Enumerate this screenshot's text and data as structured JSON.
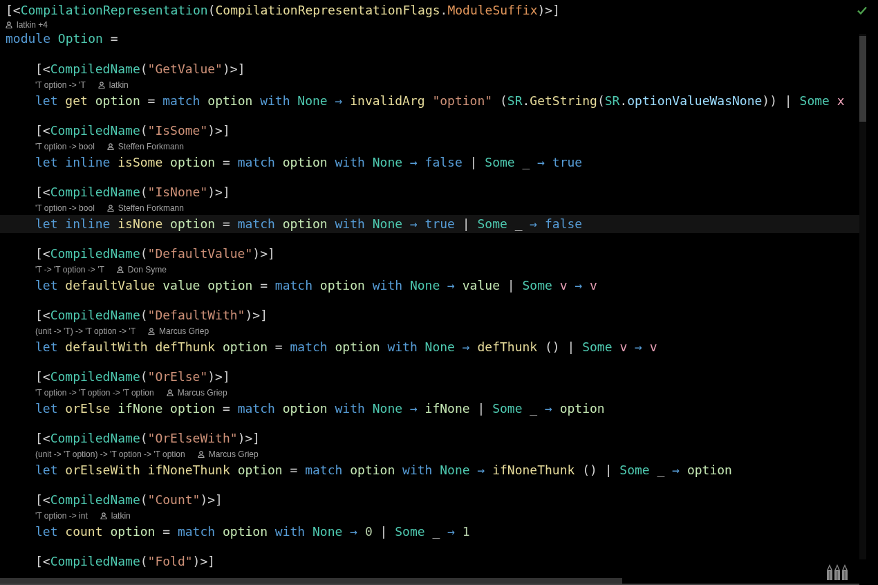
{
  "header": {
    "attribute": [
      {
        "t": "[<",
        "kind": "p"
      },
      {
        "t": "CompilationRepresentation",
        "kind": "ty"
      },
      {
        "t": "(",
        "kind": "p"
      },
      {
        "t": "CompilationRepresentationFlags",
        "kind": "fn"
      },
      {
        "t": ".",
        "kind": "p"
      },
      {
        "t": "ModuleSuffix",
        "kind": "en"
      },
      {
        "t": ")>]",
        "kind": "p"
      }
    ],
    "lens": {
      "author": "latkin +4"
    },
    "module": [
      {
        "t": "module ",
        "kind": "kw"
      },
      {
        "t": "Option",
        "kind": "ty"
      },
      {
        "t": " =",
        "kind": "p"
      }
    ]
  },
  "members": [
    {
      "attribute": [
        {
          "t": "[<",
          "kind": "p"
        },
        {
          "t": "CompiledName",
          "kind": "ty"
        },
        {
          "t": "(",
          "kind": "p"
        },
        {
          "t": "\"GetValue\"",
          "kind": "str"
        },
        {
          "t": ")>]",
          "kind": "p"
        }
      ],
      "lens": {
        "signature": "'T option -> 'T",
        "author": "latkin"
      },
      "current": false,
      "code": [
        {
          "t": "let ",
          "kind": "kw"
        },
        {
          "t": "get ",
          "kind": "fn"
        },
        {
          "t": "option ",
          "kind": "prm"
        },
        {
          "t": "= ",
          "kind": "p"
        },
        {
          "t": "match ",
          "kind": "kw"
        },
        {
          "t": "option ",
          "kind": "prm"
        },
        {
          "t": "with ",
          "kind": "kw"
        },
        {
          "t": "None ",
          "kind": "ty"
        },
        {
          "t": "→ ",
          "kind": "kw"
        },
        {
          "t": "invalidArg ",
          "kind": "fn"
        },
        {
          "t": "\"option\" ",
          "kind": "str"
        },
        {
          "t": "(",
          "kind": "p"
        },
        {
          "t": "SR",
          "kind": "ty"
        },
        {
          "t": ".",
          "kind": "p"
        },
        {
          "t": "GetString",
          "kind": "fn"
        },
        {
          "t": "(",
          "kind": "p"
        },
        {
          "t": "SR",
          "kind": "ty"
        },
        {
          "t": ".",
          "kind": "p"
        },
        {
          "t": "optionValueWasNone",
          "kind": "mem"
        },
        {
          "t": ")) | ",
          "kind": "p"
        },
        {
          "t": "Some ",
          "kind": "ty"
        },
        {
          "t": "x",
          "kind": "loc"
        }
      ]
    },
    {
      "attribute": [
        {
          "t": "[<",
          "kind": "p"
        },
        {
          "t": "CompiledName",
          "kind": "ty"
        },
        {
          "t": "(",
          "kind": "p"
        },
        {
          "t": "\"IsSome\"",
          "kind": "str"
        },
        {
          "t": ")>]",
          "kind": "p"
        }
      ],
      "lens": {
        "signature": "'T option -> bool",
        "author": "Steffen Forkmann"
      },
      "current": false,
      "code": [
        {
          "t": "let ",
          "kind": "kw"
        },
        {
          "t": "inline ",
          "kind": "kw"
        },
        {
          "t": "isSome ",
          "kind": "fn"
        },
        {
          "t": "option ",
          "kind": "prm"
        },
        {
          "t": "= ",
          "kind": "p"
        },
        {
          "t": "match ",
          "kind": "kw"
        },
        {
          "t": "option ",
          "kind": "prm"
        },
        {
          "t": "with ",
          "kind": "kw"
        },
        {
          "t": "None ",
          "kind": "ty"
        },
        {
          "t": "→ ",
          "kind": "kw"
        },
        {
          "t": "false ",
          "kind": "kw"
        },
        {
          "t": "| ",
          "kind": "p"
        },
        {
          "t": "Some ",
          "kind": "ty"
        },
        {
          "t": "_ ",
          "kind": "p"
        },
        {
          "t": "→ ",
          "kind": "kw"
        },
        {
          "t": "true",
          "kind": "kw"
        }
      ]
    },
    {
      "attribute": [
        {
          "t": "[<",
          "kind": "p"
        },
        {
          "t": "CompiledName",
          "kind": "ty"
        },
        {
          "t": "(",
          "kind": "p"
        },
        {
          "t": "\"IsNone\"",
          "kind": "str"
        },
        {
          "t": ")>]",
          "kind": "p"
        }
      ],
      "lens": {
        "signature": "'T option -> bool",
        "author": "Steffen Forkmann"
      },
      "current": true,
      "code": [
        {
          "t": "let ",
          "kind": "kw"
        },
        {
          "t": "inline ",
          "kind": "kw"
        },
        {
          "t": "isNone ",
          "kind": "fn"
        },
        {
          "t": "option ",
          "kind": "prm"
        },
        {
          "t": "= ",
          "kind": "p"
        },
        {
          "t": "match ",
          "kind": "kw"
        },
        {
          "t": "option ",
          "kind": "prm"
        },
        {
          "t": "with ",
          "kind": "kw"
        },
        {
          "t": "None ",
          "kind": "ty"
        },
        {
          "t": "→ ",
          "kind": "kw"
        },
        {
          "t": "true ",
          "kind": "kw"
        },
        {
          "t": "| ",
          "kind": "p"
        },
        {
          "t": "Some ",
          "kind": "ty"
        },
        {
          "t": "_ ",
          "kind": "p"
        },
        {
          "t": "→ ",
          "kind": "kw"
        },
        {
          "t": "false",
          "kind": "kw"
        }
      ]
    },
    {
      "attribute": [
        {
          "t": "[<",
          "kind": "p"
        },
        {
          "t": "CompiledName",
          "kind": "ty"
        },
        {
          "t": "(",
          "kind": "p"
        },
        {
          "t": "\"DefaultValue\"",
          "kind": "str"
        },
        {
          "t": ")>]",
          "kind": "p"
        }
      ],
      "lens": {
        "signature": "'T -> 'T option -> 'T",
        "author": "Don Syme"
      },
      "current": false,
      "code": [
        {
          "t": "let ",
          "kind": "kw"
        },
        {
          "t": "defaultValue ",
          "kind": "fn"
        },
        {
          "t": "value ",
          "kind": "prm"
        },
        {
          "t": "option ",
          "kind": "prm"
        },
        {
          "t": "= ",
          "kind": "p"
        },
        {
          "t": "match ",
          "kind": "kw"
        },
        {
          "t": "option ",
          "kind": "prm"
        },
        {
          "t": "with ",
          "kind": "kw"
        },
        {
          "t": "None ",
          "kind": "ty"
        },
        {
          "t": "→ ",
          "kind": "kw"
        },
        {
          "t": "value ",
          "kind": "prm"
        },
        {
          "t": "| ",
          "kind": "p"
        },
        {
          "t": "Some ",
          "kind": "ty"
        },
        {
          "t": "v ",
          "kind": "loc"
        },
        {
          "t": "→ ",
          "kind": "kw"
        },
        {
          "t": "v",
          "kind": "loc"
        }
      ]
    },
    {
      "attribute": [
        {
          "t": "[<",
          "kind": "p"
        },
        {
          "t": "CompiledName",
          "kind": "ty"
        },
        {
          "t": "(",
          "kind": "p"
        },
        {
          "t": "\"DefaultWith\"",
          "kind": "str"
        },
        {
          "t": ")>]",
          "kind": "p"
        }
      ],
      "lens": {
        "signature": "(unit -> 'T) -> 'T option -> 'T",
        "author": "Marcus Griep"
      },
      "current": false,
      "code": [
        {
          "t": "let ",
          "kind": "kw"
        },
        {
          "t": "defaultWith ",
          "kind": "fn"
        },
        {
          "t": "defThunk ",
          "kind": "fn"
        },
        {
          "t": "option ",
          "kind": "prm"
        },
        {
          "t": "= ",
          "kind": "p"
        },
        {
          "t": "match ",
          "kind": "kw"
        },
        {
          "t": "option ",
          "kind": "prm"
        },
        {
          "t": "with ",
          "kind": "kw"
        },
        {
          "t": "None ",
          "kind": "ty"
        },
        {
          "t": "→ ",
          "kind": "kw"
        },
        {
          "t": "defThunk ",
          "kind": "fn"
        },
        {
          "t": "() | ",
          "kind": "p"
        },
        {
          "t": "Some ",
          "kind": "ty"
        },
        {
          "t": "v ",
          "kind": "loc"
        },
        {
          "t": "→ ",
          "kind": "kw"
        },
        {
          "t": "v",
          "kind": "loc"
        }
      ]
    },
    {
      "attribute": [
        {
          "t": "[<",
          "kind": "p"
        },
        {
          "t": "CompiledName",
          "kind": "ty"
        },
        {
          "t": "(",
          "kind": "p"
        },
        {
          "t": "\"OrElse\"",
          "kind": "str"
        },
        {
          "t": ")>]",
          "kind": "p"
        }
      ],
      "lens": {
        "signature": "'T option -> 'T option -> 'T option",
        "author": "Marcus Griep"
      },
      "current": false,
      "code": [
        {
          "t": "let ",
          "kind": "kw"
        },
        {
          "t": "orElse ",
          "kind": "fn"
        },
        {
          "t": "ifNone ",
          "kind": "prm"
        },
        {
          "t": "option ",
          "kind": "prm"
        },
        {
          "t": "= ",
          "kind": "p"
        },
        {
          "t": "match ",
          "kind": "kw"
        },
        {
          "t": "option ",
          "kind": "prm"
        },
        {
          "t": "with ",
          "kind": "kw"
        },
        {
          "t": "None ",
          "kind": "ty"
        },
        {
          "t": "→ ",
          "kind": "kw"
        },
        {
          "t": "ifNone ",
          "kind": "prm"
        },
        {
          "t": "| ",
          "kind": "p"
        },
        {
          "t": "Some ",
          "kind": "ty"
        },
        {
          "t": "_ ",
          "kind": "p"
        },
        {
          "t": "→ ",
          "kind": "kw"
        },
        {
          "t": "option",
          "kind": "prm"
        }
      ]
    },
    {
      "attribute": [
        {
          "t": "[<",
          "kind": "p"
        },
        {
          "t": "CompiledName",
          "kind": "ty"
        },
        {
          "t": "(",
          "kind": "p"
        },
        {
          "t": "\"OrElseWith\"",
          "kind": "str"
        },
        {
          "t": ")>]",
          "kind": "p"
        }
      ],
      "lens": {
        "signature": "(unit -> 'T option) -> 'T option -> 'T option",
        "author": "Marcus Griep"
      },
      "current": false,
      "code": [
        {
          "t": "let ",
          "kind": "kw"
        },
        {
          "t": "orElseWith ",
          "kind": "fn"
        },
        {
          "t": "ifNoneThunk ",
          "kind": "fn"
        },
        {
          "t": "option ",
          "kind": "prm"
        },
        {
          "t": "= ",
          "kind": "p"
        },
        {
          "t": "match ",
          "kind": "kw"
        },
        {
          "t": "option ",
          "kind": "prm"
        },
        {
          "t": "with ",
          "kind": "kw"
        },
        {
          "t": "None ",
          "kind": "ty"
        },
        {
          "t": "→ ",
          "kind": "kw"
        },
        {
          "t": "ifNoneThunk ",
          "kind": "fn"
        },
        {
          "t": "() | ",
          "kind": "p"
        },
        {
          "t": "Some ",
          "kind": "ty"
        },
        {
          "t": "_ ",
          "kind": "p"
        },
        {
          "t": "→ ",
          "kind": "kw"
        },
        {
          "t": "option",
          "kind": "prm"
        }
      ]
    },
    {
      "attribute": [
        {
          "t": "[<",
          "kind": "p"
        },
        {
          "t": "CompiledName",
          "kind": "ty"
        },
        {
          "t": "(",
          "kind": "p"
        },
        {
          "t": "\"Count\"",
          "kind": "str"
        },
        {
          "t": ")>]",
          "kind": "p"
        }
      ],
      "lens": {
        "signature": "'T option -> int",
        "author": "latkin"
      },
      "current": false,
      "code": [
        {
          "t": "let ",
          "kind": "kw"
        },
        {
          "t": "count ",
          "kind": "fn"
        },
        {
          "t": "option ",
          "kind": "prm"
        },
        {
          "t": "= ",
          "kind": "p"
        },
        {
          "t": "match ",
          "kind": "kw"
        },
        {
          "t": "option ",
          "kind": "prm"
        },
        {
          "t": "with ",
          "kind": "kw"
        },
        {
          "t": "None ",
          "kind": "ty"
        },
        {
          "t": "→ ",
          "kind": "kw"
        },
        {
          "t": "0 ",
          "kind": "num"
        },
        {
          "t": "| ",
          "kind": "p"
        },
        {
          "t": "Some ",
          "kind": "ty"
        },
        {
          "t": "_ ",
          "kind": "p"
        },
        {
          "t": "→ ",
          "kind": "kw"
        },
        {
          "t": "1",
          "kind": "num"
        }
      ]
    }
  ],
  "trailing_attribute": [
    {
      "t": "[<",
      "kind": "p"
    },
    {
      "t": "CompiledName",
      "kind": "ty"
    },
    {
      "t": "(",
      "kind": "p"
    },
    {
      "t": "\"Fold\"",
      "kind": "str"
    },
    {
      "t": ")>]",
      "kind": "p"
    }
  ]
}
